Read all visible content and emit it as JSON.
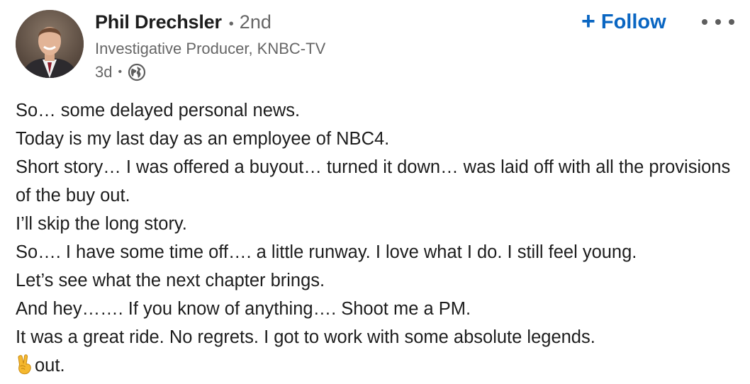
{
  "author": {
    "name": "Phil Drechsler",
    "separator": "•",
    "degree": "2nd",
    "headline": "Investigative Producer, KNBC-TV",
    "time": "3d",
    "time_separator": "•",
    "visibility_icon": "globe-icon",
    "avatar_icon": "avatar"
  },
  "actions": {
    "follow_plus": "+",
    "follow_label": "Follow",
    "more_icon": "more-dots-icon"
  },
  "post": {
    "lines": [
      "So… some delayed personal news.",
      "Today is my last day as an employee of NBC4.",
      "Short story… I was offered a buyout… turned it down… was laid off with all the provisions of the buy out.",
      "I’ll skip the long story.",
      "So…. I have some time off…. a little runway. I love what I do. I still feel young.",
      "Let’s see what the next chapter brings.",
      "And hey……. If you know of anything…. Shoot me a PM.",
      "It was a great ride. No regrets. I got to work with some absolute legends."
    ],
    "last_line_emoji": "victory-hand-emoji",
    "last_line_text": "out."
  },
  "colors": {
    "accent": "#0a66c2",
    "text_primary": "#1d1d1d",
    "text_secondary": "#666666"
  }
}
